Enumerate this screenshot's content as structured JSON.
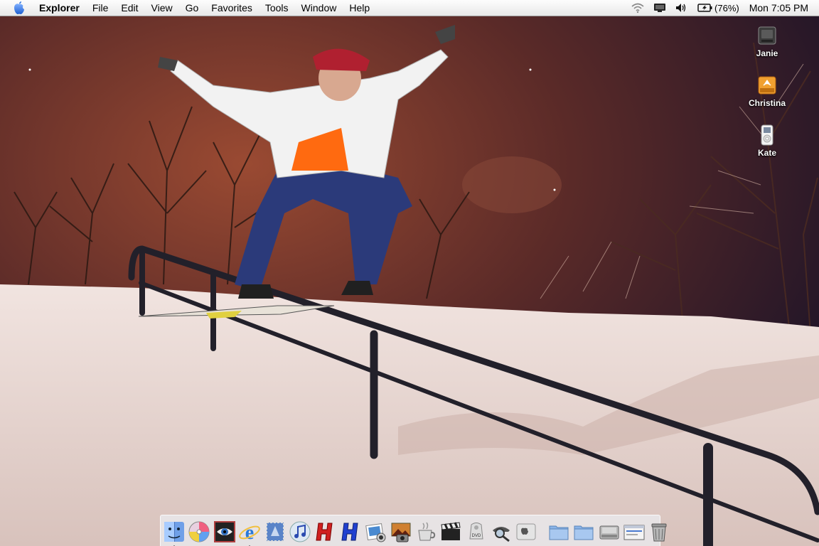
{
  "menubar": {
    "app_name": "Explorer",
    "menus": [
      "File",
      "Edit",
      "View",
      "Go",
      "Favorites",
      "Tools",
      "Window",
      "Help"
    ],
    "battery_percent": "(76%)",
    "clock": "Mon 7:05 PM",
    "icons": [
      "apple-icon",
      "wifi-icon",
      "display-icon",
      "volume-icon",
      "battery-icon"
    ]
  },
  "desktop_icons": [
    {
      "label": "Janie",
      "icon": "hard-drive-icon"
    },
    {
      "label": "Christina",
      "icon": "firewire-drive-icon"
    },
    {
      "label": "Kate",
      "icon": "ipod-icon"
    }
  ],
  "dock": {
    "apps": [
      {
        "name": "finder-icon",
        "running": true
      },
      {
        "name": "dvd-disc-icon",
        "running": false
      },
      {
        "name": "eye-preview-icon",
        "running": false
      },
      {
        "name": "internet-explorer-icon",
        "running": true
      },
      {
        "name": "mail-stamp-icon",
        "running": false
      },
      {
        "name": "itunes-icon",
        "running": false
      },
      {
        "name": "red-h-icon",
        "running": false
      },
      {
        "name": "blue-h-icon",
        "running": false
      },
      {
        "name": "iphoto-icon",
        "running": false
      },
      {
        "name": "image-capture-icon",
        "running": false
      },
      {
        "name": "coffee-cup-icon",
        "running": false
      },
      {
        "name": "clapperboard-icon",
        "running": false
      },
      {
        "name": "dvd-player-icon",
        "running": false
      },
      {
        "name": "magnifier-icon",
        "running": false
      },
      {
        "name": "system-preferences-icon",
        "running": false
      }
    ],
    "docs": [
      {
        "name": "folder-icon"
      },
      {
        "name": "folder-icon"
      },
      {
        "name": "drive-icon"
      },
      {
        "name": "window-icon"
      },
      {
        "name": "trash-icon"
      }
    ],
    "dvd_label": "DVD"
  },
  "colors": {
    "sky": "#5b2a1e",
    "snow": "#efe2de",
    "rail": "#22202a"
  }
}
